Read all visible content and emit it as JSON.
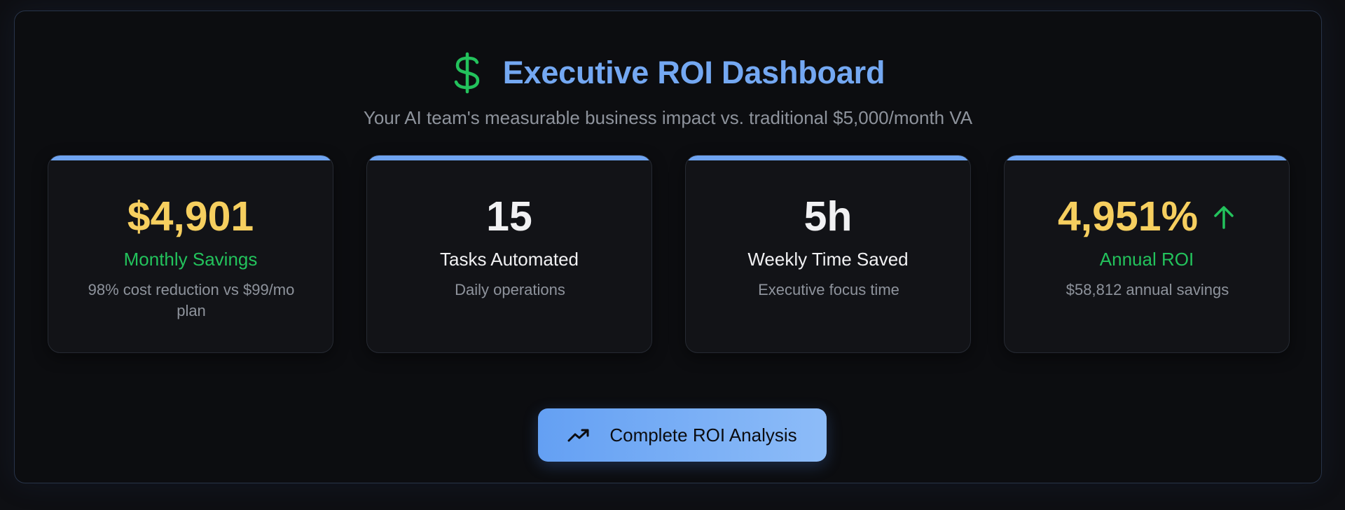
{
  "header": {
    "title": "Executive ROI Dashboard",
    "subtitle": "Your AI team's measurable business impact vs. traditional $5,000/month VA",
    "icon": "dollar-icon"
  },
  "cards": [
    {
      "value": "$4,901",
      "label": "Monthly Savings",
      "description": "98% cost reduction vs $99/mo plan"
    },
    {
      "value": "15",
      "label": "Tasks Automated",
      "description": "Daily operations"
    },
    {
      "value": "5h",
      "label": "Weekly Time Saved",
      "description": "Executive focus time"
    },
    {
      "value": "4,951%",
      "label": "Annual ROI",
      "description": "$58,812 annual savings",
      "trend_icon": "arrow-up-icon"
    }
  ],
  "cta": {
    "label": "Complete ROI Analysis",
    "icon": "trending-up-icon"
  },
  "colors": {
    "accent_blue": "#74a8f2",
    "card_bar": "#6fa4f0",
    "gold": "#f6cf5f",
    "green": "#23c25c",
    "muted_text": "#8e939c",
    "background": "#0c0d10"
  }
}
